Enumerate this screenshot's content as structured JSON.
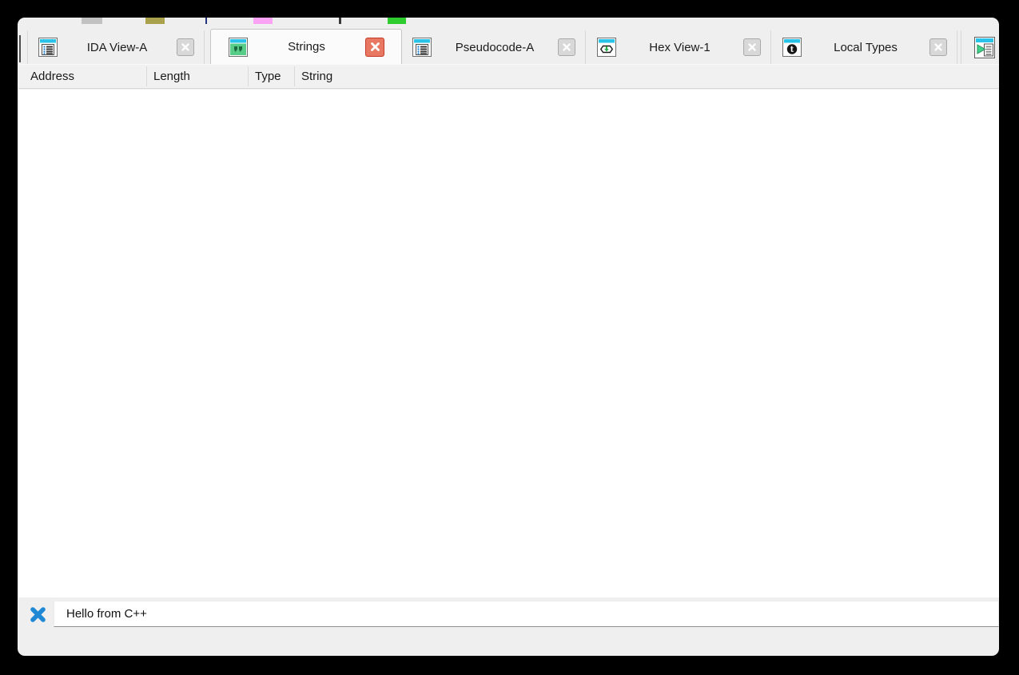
{
  "window": {
    "title": "Strings view (IDA)",
    "background": "#efefef"
  },
  "toolbar_fragments": [
    {
      "name": "gray-fragment",
      "color": "#c2c2c2"
    },
    {
      "name": "olive-fragment",
      "color": "#aaa14d"
    },
    {
      "name": "navy-tick-fragment",
      "color": "#27357d"
    },
    {
      "name": "pink-fragment",
      "color": "#fba4f5"
    },
    {
      "name": "dark-mark-fragment",
      "color": "#3a3a3a"
    },
    {
      "name": "green-fragment",
      "color": "#2fcc2f"
    }
  ],
  "tab_bar": {
    "tabs": [
      {
        "label": "IDA View-A",
        "icon": "list-window-icon",
        "active": false
      },
      {
        "label": "Strings",
        "icon": "strings-window-icon",
        "active": true
      },
      {
        "label": "Pseudocode-A",
        "icon": "list-window-icon",
        "active": false
      },
      {
        "label": "Hex View-1",
        "icon": "hex-window-icon",
        "active": false
      },
      {
        "label": "Local Types",
        "icon": "local-types-window-icon",
        "active": false
      },
      {
        "label": "",
        "icon": "exports-window-icon",
        "active": false,
        "clipped": true
      }
    ]
  },
  "table": {
    "columns": [
      "Address",
      "Length",
      "Type",
      "String"
    ],
    "rows": []
  },
  "filter_bar": {
    "clear_icon": "blue-cross-icon",
    "value": "Hello from C++"
  },
  "colors": {
    "icon_titlebar_cyan": "#29c3e9",
    "strings_icon_green": "#57cd89",
    "active_close_red": "#e97862",
    "filter_cross_blue": "#1e88d5",
    "canvas_black": "#000000"
  }
}
